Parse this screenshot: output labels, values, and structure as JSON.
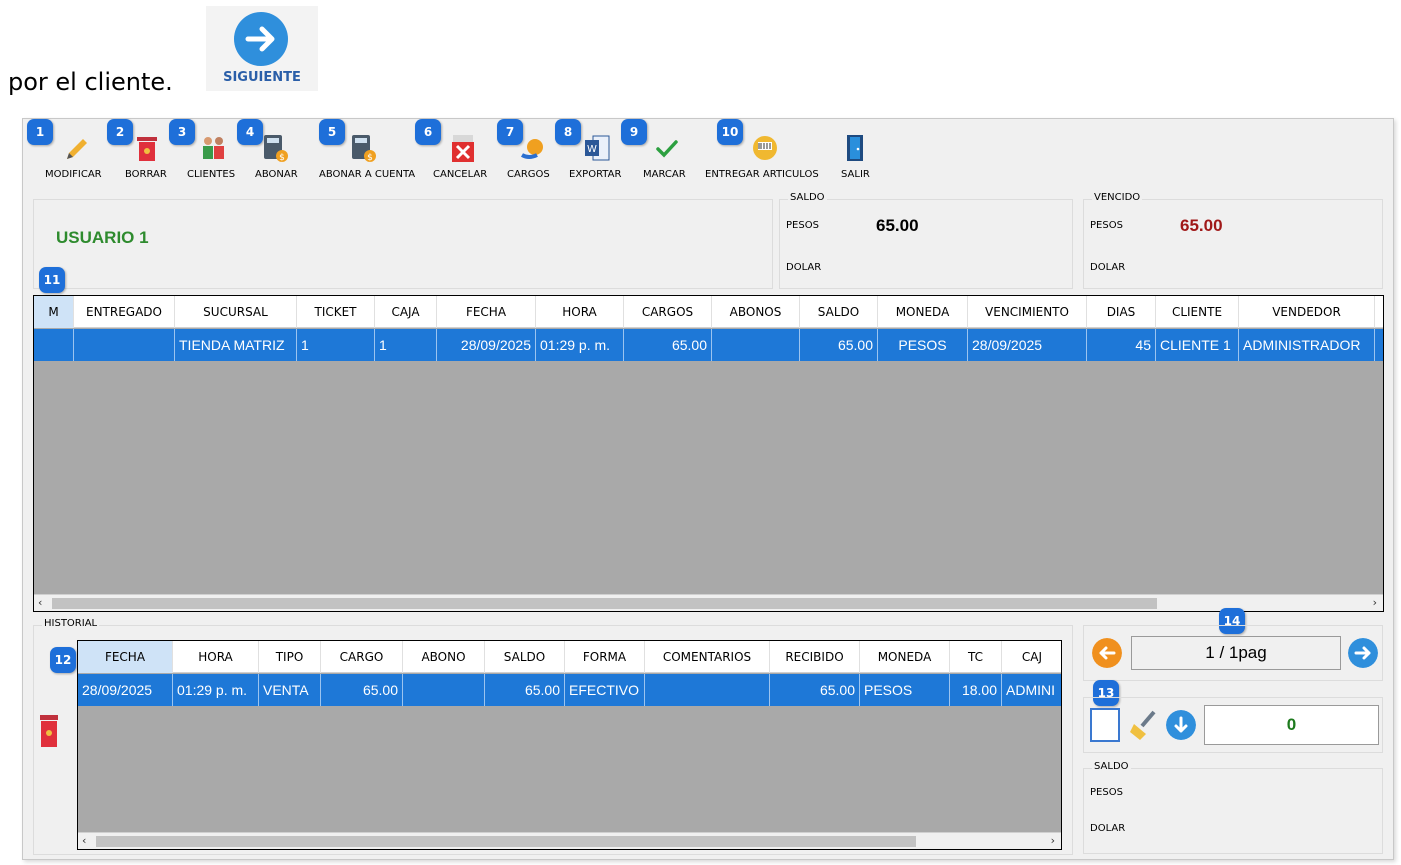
{
  "intro": {
    "text": "por el cliente.",
    "next_button_label": "SIGUIENTE"
  },
  "toolbar": {
    "items": [
      {
        "label": "MODIFICAR",
        "badge": "1"
      },
      {
        "label": "BORRAR",
        "badge": "2"
      },
      {
        "label": "CLIENTES",
        "badge": "3"
      },
      {
        "label": "ABONAR",
        "badge": "4"
      },
      {
        "label": "ABONAR A CUENTA",
        "badge": "5"
      },
      {
        "label": "CANCELAR",
        "badge": "6"
      },
      {
        "label": "CARGOS",
        "badge": "7"
      },
      {
        "label": "EXPORTAR",
        "badge": "8"
      },
      {
        "label": "MARCAR",
        "badge": "9"
      },
      {
        "label": "ENTREGAR ARTICULOS",
        "badge": "10"
      },
      {
        "label": "SALIR"
      }
    ]
  },
  "user": {
    "name": "USUARIO 1"
  },
  "saldo": {
    "title": "SALDO",
    "pesos_label": "PESOS",
    "pesos_value": "65.00",
    "dolar_label": "DOLAR"
  },
  "vencido": {
    "title": "VENCIDO",
    "pesos_label": "PESOS",
    "pesos_value": "65.00",
    "dolar_label": "DOLAR"
  },
  "main_grid": {
    "badge": "11",
    "columns": [
      "M",
      "ENTREGADO",
      "SUCURSAL",
      "TICKET",
      "CAJA",
      "FECHA",
      "HORA",
      "CARGOS",
      "ABONOS",
      "SALDO",
      "MONEDA",
      "VENCIMIENTO",
      "DIAS",
      "CLIENTE",
      "VENDEDOR"
    ],
    "row": [
      "",
      "",
      "TIENDA MATRIZ",
      "1",
      "1",
      "28/09/2025",
      "01:29 p. m.",
      "65.00",
      "",
      "65.00",
      "PESOS",
      "28/09/2025",
      "45",
      "CLIENTE 1",
      "ADMINISTRADOR"
    ]
  },
  "historial": {
    "title": "HISTORIAL",
    "badge": "12",
    "columns": [
      "FECHA",
      "HORA",
      "TIPO",
      "CARGO",
      "ABONO",
      "SALDO",
      "FORMA",
      "COMENTARIOS",
      "RECIBIDO",
      "MONEDA",
      "TC",
      "CAJ"
    ],
    "row": [
      "28/09/2025",
      "01:29 p. m.",
      "VENTA",
      "65.00",
      "",
      "65.00",
      "EFECTIVO",
      "",
      "65.00",
      "PESOS",
      "18.00",
      "ADMINI"
    ]
  },
  "pagination": {
    "badge": "14",
    "page_text": "1 / 1pag"
  },
  "marking": {
    "badge": "13",
    "count": "0"
  },
  "saldo2": {
    "title": "SALDO",
    "pesos_label": "PESOS",
    "dolar_label": "DOLAR"
  },
  "colors": {
    "accent": "#1e78d7",
    "badge": "#1e6fd9",
    "user_green": "#2e8b2e",
    "vencido_red": "#a01818",
    "orange": "#f0901e"
  }
}
